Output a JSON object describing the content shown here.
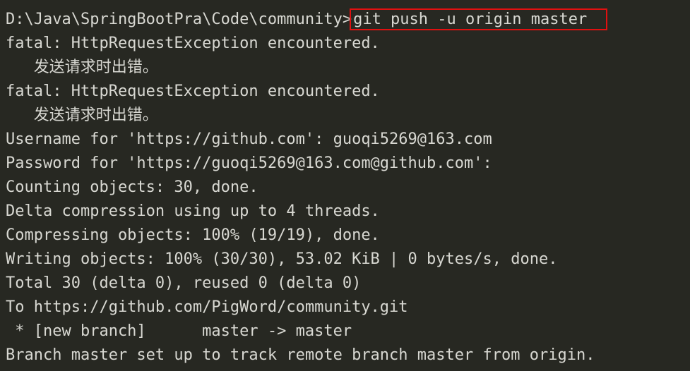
{
  "terminal": {
    "prompt": "D:\\Java\\SpringBootPra\\Code\\community>",
    "command": "git push -u origin master",
    "highlight_color": "#e01010",
    "output": [
      "fatal: HttpRequestException encountered.",
      "   发送请求时出错。",
      "fatal: HttpRequestException encountered.",
      "   发送请求时出错。",
      "Username for 'https://github.com': guoqi5269@163.com",
      "Password for 'https://guoqi5269@163.com@github.com':",
      "Counting objects: 30, done.",
      "Delta compression using up to 4 threads.",
      "Compressing objects: 100% (19/19), done.",
      "Writing objects: 100% (30/30), 53.02 KiB | 0 bytes/s, done.",
      "Total 30 (delta 0), reused 0 (delta 0)",
      "To https://github.com/PigWord/community.git",
      " * [new branch]      master -> master",
      "Branch master set up to track remote branch master from origin."
    ]
  }
}
